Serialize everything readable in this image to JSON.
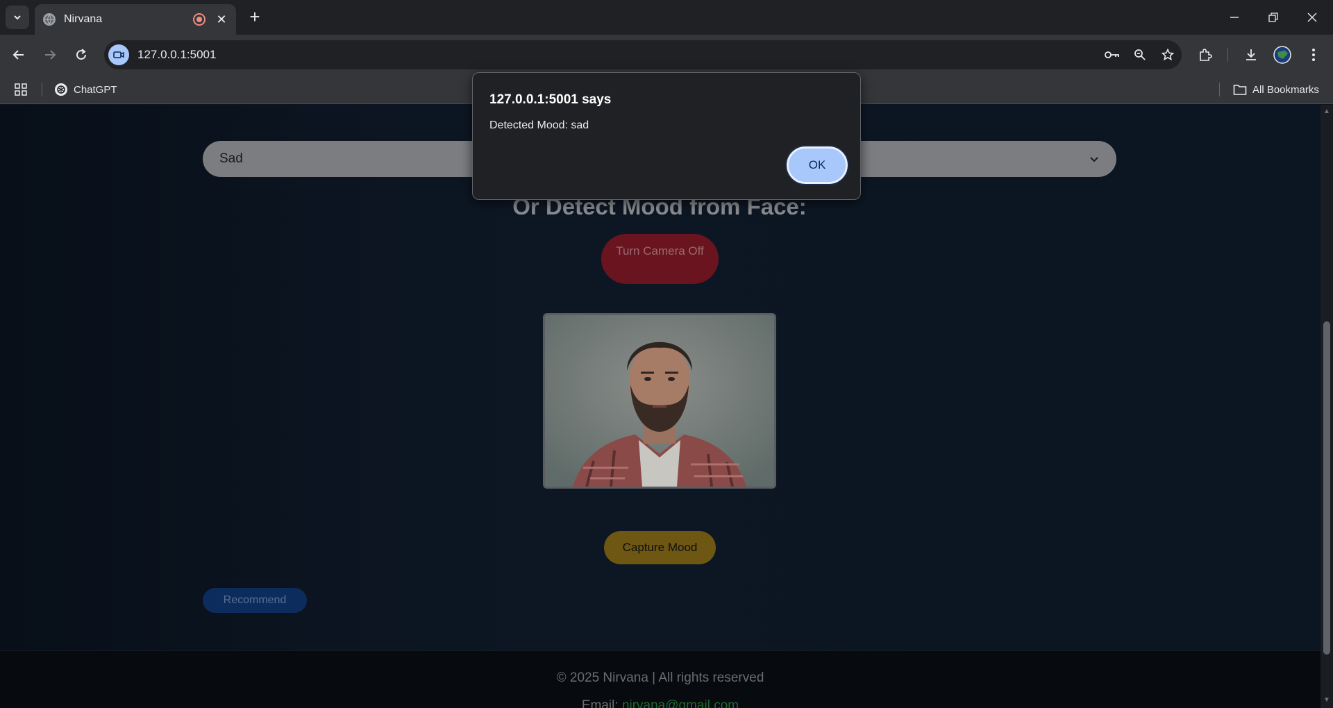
{
  "browser": {
    "tab_title": "Nirvana",
    "url": "127.0.0.1:5001",
    "bookmarks": [
      {
        "label": "ChatGPT"
      }
    ],
    "all_bookmarks_label": "All Bookmarks"
  },
  "page": {
    "mood_select": {
      "selected": "Sad"
    },
    "heading": "Or Detect Mood from Face:",
    "camera_button": "Turn Camera Off",
    "capture_button": "Capture Mood",
    "recommend_button": "Recommend",
    "footer": {
      "copyright": "© 2025 Nirvana | All rights reserved",
      "email_label": "Email:",
      "email": "nirvana@gmail.com"
    }
  },
  "dialog": {
    "title": "127.0.0.1:5001 says",
    "message": "Detected Mood: sad",
    "ok_label": "OK"
  },
  "colors": {
    "accent": "#a8c7fa",
    "camera_button": "#6a1420",
    "capture_button": "#6e5713",
    "recommend_button": "#0d2c5e"
  }
}
